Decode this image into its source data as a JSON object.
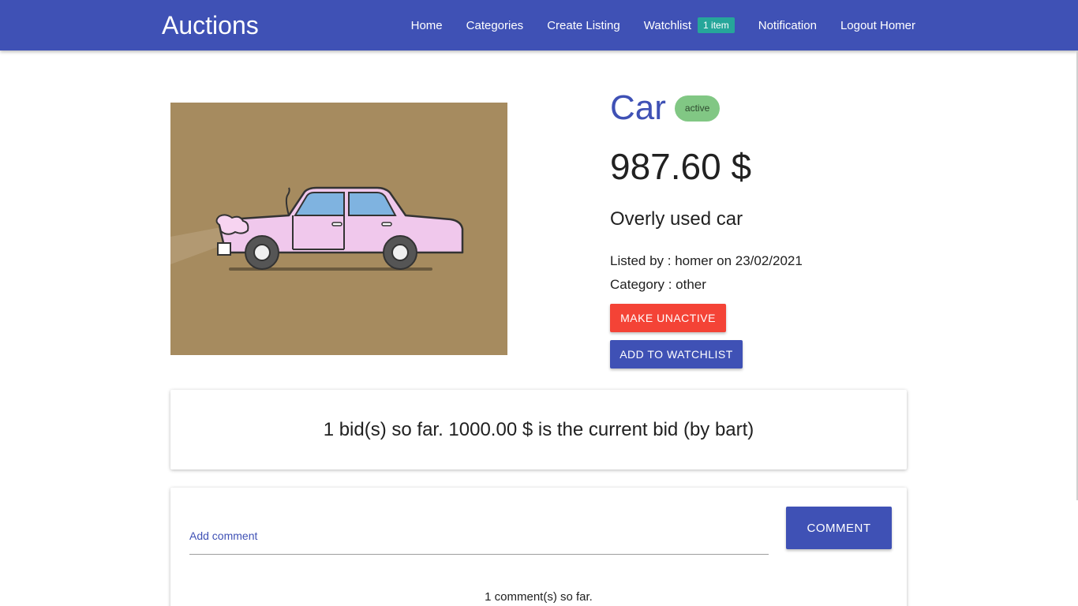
{
  "navbar": {
    "brand": "Auctions",
    "links": {
      "home": "Home",
      "categories": "Categories",
      "create_listing": "Create Listing",
      "watchlist": "Watchlist",
      "watchlist_badge": "1 item",
      "notification": "Notification",
      "logout": "Logout Homer"
    },
    "color": "#3f51b5"
  },
  "listing": {
    "title": "Car",
    "status": "active",
    "price": "987.60 $",
    "description": "Overly used car",
    "listed_by": "Listed by : homer on 23/02/2021",
    "category": "Category : other",
    "image_icon": "pink-car-illustration"
  },
  "actions": {
    "make_unactive": "MAKE UNACTIVE",
    "add_to_watchlist": "ADD TO WATCHLIST"
  },
  "bids": {
    "summary": "1 bid(s) so far. 1000.00 $ is the current bid (by bart)"
  },
  "comments": {
    "input_label": "Add comment",
    "button": "COMMENT",
    "count_text": "1 comment(s) so far."
  },
  "colors": {
    "primary": "#3f51b5",
    "danger": "#f44336",
    "status_active": "#81c784",
    "badge": "#26a69a"
  }
}
